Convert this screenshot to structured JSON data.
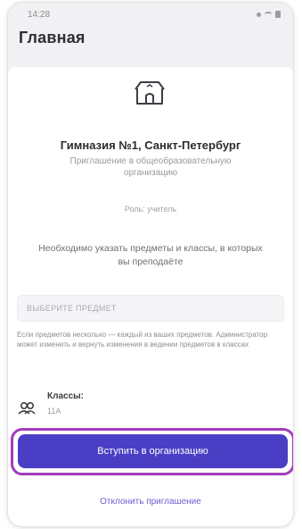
{
  "status_bar": {
    "time": "14:28"
  },
  "header": {
    "title": "Главная"
  },
  "organization": {
    "icon": "building-icon",
    "name": "Гимназия №1, Санкт-Петербург",
    "invite_text": "Приглашение в общеобразовательную организацию",
    "role": "Роль: учитель"
  },
  "notice": "Необходимо указать предметы и классы, в которых вы преподаёте",
  "subject_field": {
    "placeholder": "ВЫБЕРИТЕ ПРЕДМЕТ"
  },
  "hint": "Если предметов несколько — каждый из ваших предметов. Администратор может изменить и вернуть изменения в ведении предметов в классах",
  "classes": {
    "icon": "people-icon",
    "label": "Классы:",
    "value": "11А"
  },
  "actions": {
    "join_label": "Вступить в организацию",
    "decline_label": "Отклонить приглашение"
  },
  "colors": {
    "accent": "#4a3fc4",
    "highlight": "#a43cc0",
    "link": "#6a5fd0"
  }
}
